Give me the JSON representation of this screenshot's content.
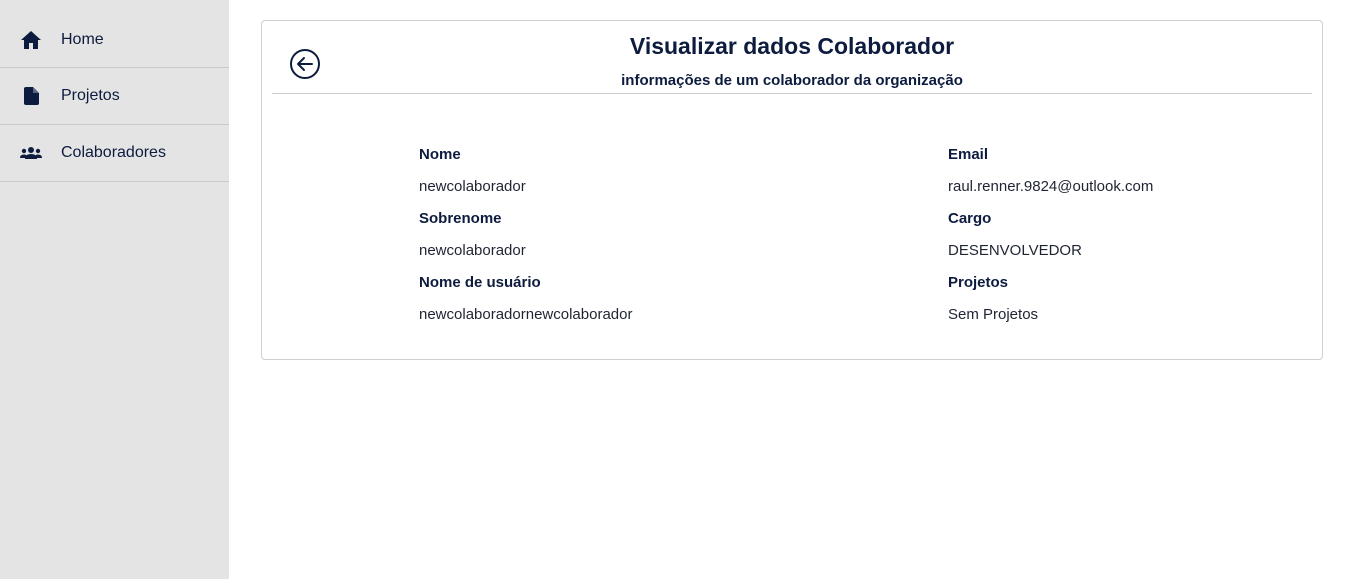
{
  "sidebar": {
    "items": [
      {
        "label": "Home",
        "icon": "home-icon"
      },
      {
        "label": "Projetos",
        "icon": "document-icon"
      },
      {
        "label": "Colaboradores",
        "icon": "people-icon"
      }
    ]
  },
  "header": {
    "title": "Visualizar dados Colaborador",
    "subtitle": "informações de um colaborador da organização",
    "back_icon": "arrow-left-circle-icon"
  },
  "details": {
    "left": [
      {
        "label": "Nome",
        "value": "newcolaborador"
      },
      {
        "label": "Sobrenome",
        "value": "newcolaborador"
      },
      {
        "label": "Nome de usuário",
        "value": "newcolaboradornewcolaborador"
      }
    ],
    "right": [
      {
        "label": "Email",
        "value": "raul.renner.9824@outlook.com"
      },
      {
        "label": "Cargo",
        "value": "DESENVOLVEDOR"
      },
      {
        "label": "Projetos",
        "value": "Sem Projetos"
      }
    ]
  },
  "colors": {
    "sidebar_bg": "#e4e4e4",
    "primary_text": "#0d1b3e",
    "border": "#cfcfcf"
  }
}
